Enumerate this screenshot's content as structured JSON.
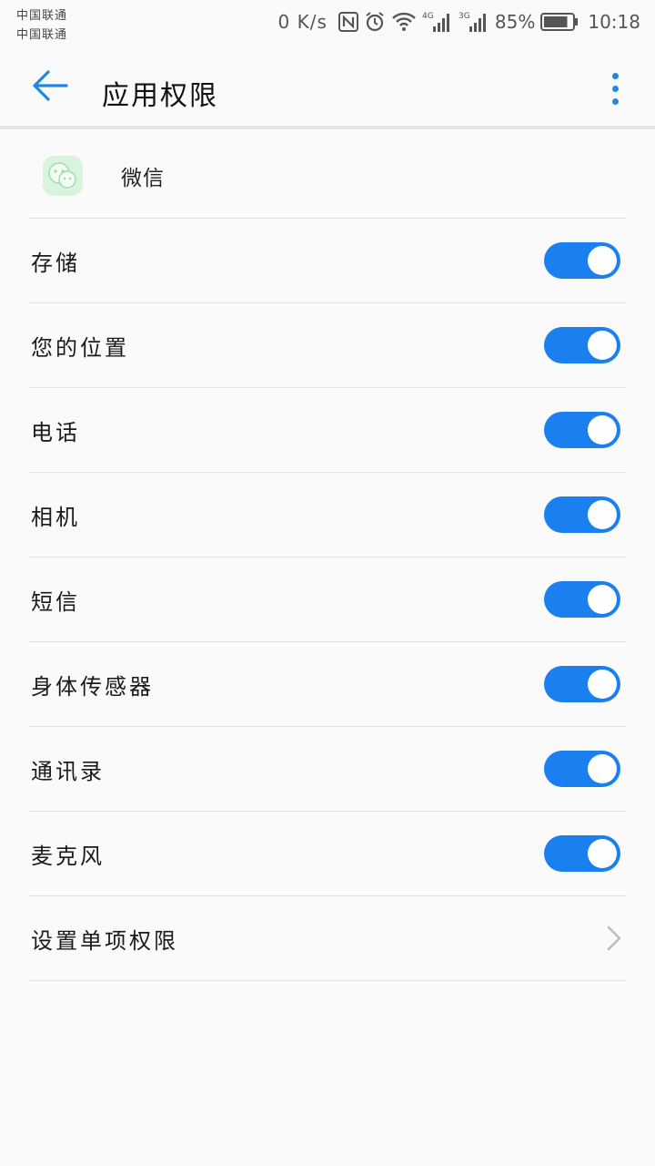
{
  "status_bar": {
    "carrier_1": "中国联通",
    "carrier_2": "中国联通",
    "net_speed": "0 K/s",
    "nfc_icon": "nfc-icon",
    "alarm_icon": "alarm-icon",
    "wifi_icon": "wifi-icon",
    "signal_1_label": "4G",
    "signal_2_label": "3G",
    "battery_percent": "85%",
    "battery_level": 0.85,
    "time": "10:18"
  },
  "app_bar": {
    "back_icon": "arrow-back-icon",
    "title": "应用权限",
    "more_icon": "more-vert-icon",
    "accent_color": "#1e88e5"
  },
  "app": {
    "icon": "wechat-icon",
    "name": "微信"
  },
  "permissions": [
    {
      "label": "存储",
      "enabled": true
    },
    {
      "label": "您的位置",
      "enabled": true
    },
    {
      "label": "电话",
      "enabled": true
    },
    {
      "label": "相机",
      "enabled": true
    },
    {
      "label": "短信",
      "enabled": true
    },
    {
      "label": "身体传感器",
      "enabled": true
    },
    {
      "label": "通讯录",
      "enabled": true
    },
    {
      "label": "麦克风",
      "enabled": true
    }
  ],
  "individual_permissions": {
    "label": "设置单项权限",
    "icon": "chevron-right-icon"
  },
  "colors": {
    "toggle_on": "#1a80f0",
    "background": "#fafafa",
    "divider": "#e0e0e0"
  }
}
